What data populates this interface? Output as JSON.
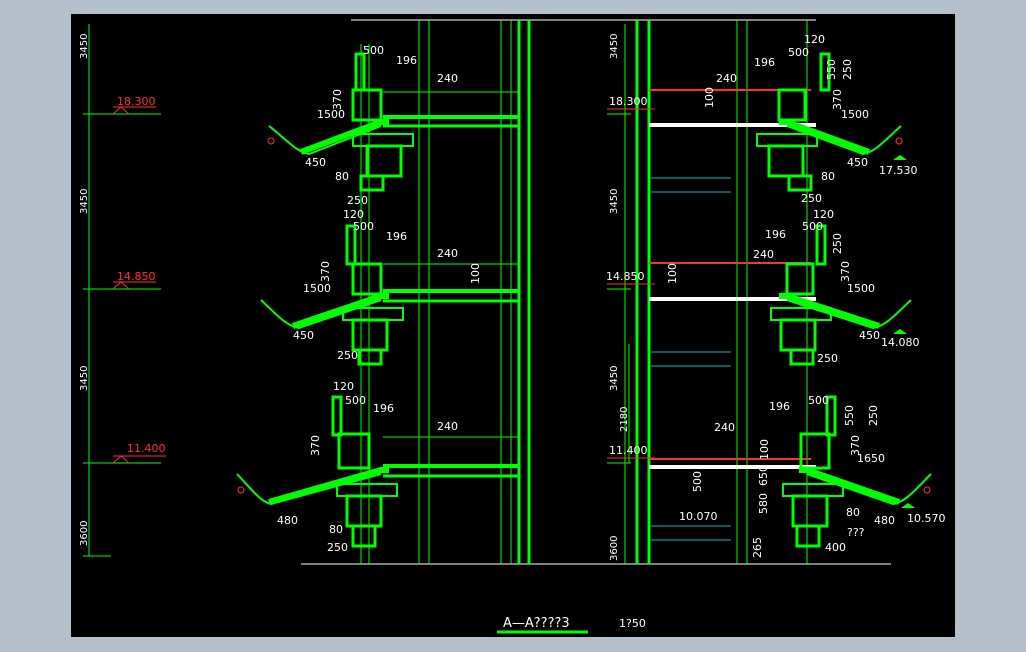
{
  "drawing": {
    "caption": "A—A????3",
    "scale": "1?50",
    "colors": {
      "background": "#000000",
      "frame": "#b4bfcc",
      "structure": "#00ff00",
      "structure_dark": "#00b400",
      "dimension": "#ffffff",
      "elevation_red": "#ff3030",
      "tick": "#c000c0",
      "cyan": "#00c0c0"
    }
  },
  "left_dims": {
    "vertical": [
      "3450",
      "3450",
      "3450",
      "3600"
    ],
    "elevations": [
      "18.300",
      "14.850",
      "11.400"
    ]
  },
  "center_dims": {
    "vertical": [
      "3450",
      "3450",
      "3450",
      "3600"
    ],
    "elevations": [
      "18.300",
      "14.850",
      "11.400"
    ],
    "extra": [
      "2180"
    ]
  },
  "left_labels": {
    "tier1": [
      "500",
      "196",
      "240",
      "370",
      "1500",
      "450",
      "80",
      "250"
    ],
    "tier2": [
      "120",
      "500",
      "196",
      "240",
      "100",
      "370",
      "1500",
      "450",
      "250"
    ],
    "tier3": [
      "120",
      "500",
      "196",
      "240",
      "370",
      "480",
      "80",
      "250"
    ]
  },
  "right_labels": {
    "tier1": [
      "120",
      "500",
      "196",
      "250",
      "550",
      "240",
      "100",
      "370",
      "1500",
      "450",
      "80",
      "250"
    ],
    "tier2": [
      "120",
      "500",
      "196",
      "240",
      "250",
      "370",
      "100",
      "1500",
      "450",
      "250"
    ],
    "tier3": [
      "500",
      "196",
      "250",
      "550",
      "240",
      "100",
      "370",
      "1650",
      "500",
      "580",
      "650",
      "80",
      "480",
      "265",
      "400",
      "???"
    ],
    "extra": [
      "10.070"
    ],
    "elevations": [
      "17.530",
      "14.080",
      "10.570"
    ]
  }
}
